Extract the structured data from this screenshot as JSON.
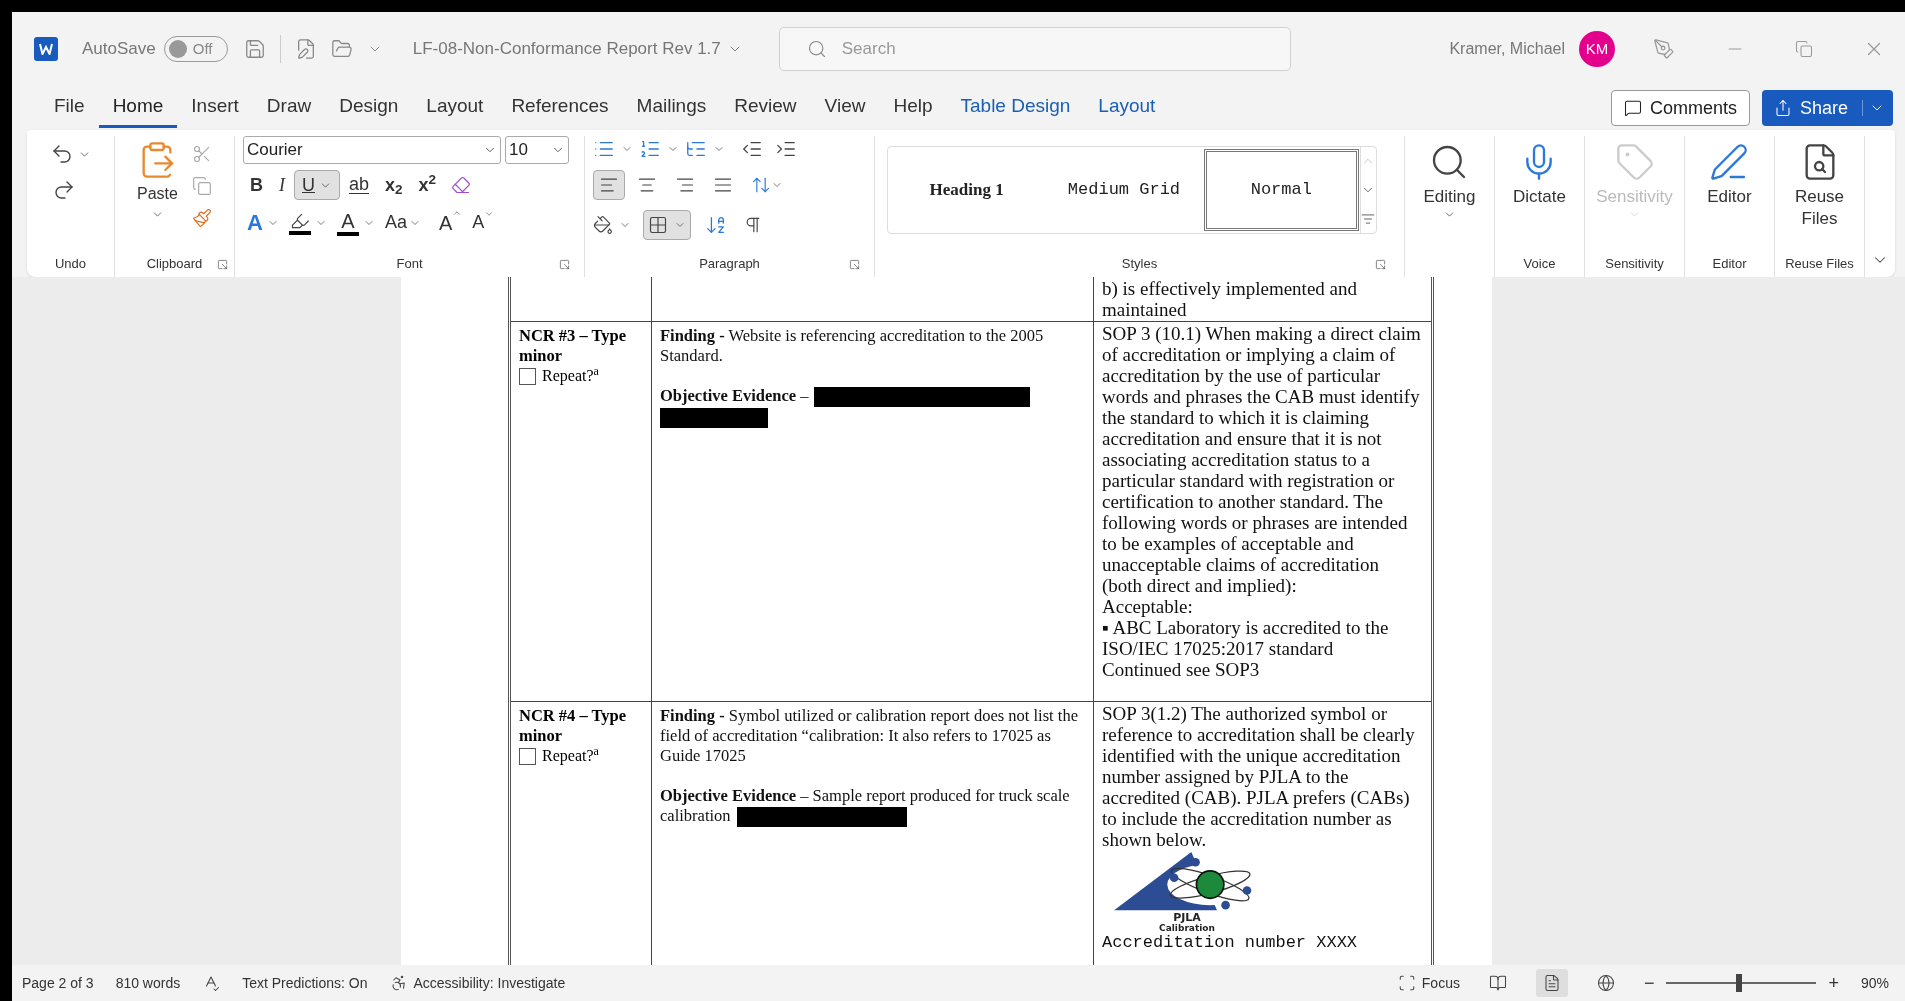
{
  "title_bar": {
    "autosave": {
      "label": "AutoSave",
      "state": "Off",
      "on": false
    },
    "document_title": "LF-08-Non-Conformance Report Rev 1.7",
    "search": {
      "placeholder": "Search"
    },
    "user_name": "Kramer, Michael",
    "user_initials": "KM"
  },
  "menu_tabs": [
    {
      "label": "File",
      "selected": false,
      "kind": "normal"
    },
    {
      "label": "Home",
      "selected": true,
      "kind": "normal"
    },
    {
      "label": "Insert",
      "selected": false,
      "kind": "normal"
    },
    {
      "label": "Draw",
      "selected": false,
      "kind": "normal"
    },
    {
      "label": "Design",
      "selected": false,
      "kind": "normal"
    },
    {
      "label": "Layout",
      "selected": false,
      "kind": "normal"
    },
    {
      "label": "References",
      "selected": false,
      "kind": "normal"
    },
    {
      "label": "Mailings",
      "selected": false,
      "kind": "normal"
    },
    {
      "label": "Review",
      "selected": false,
      "kind": "normal"
    },
    {
      "label": "View",
      "selected": false,
      "kind": "normal"
    },
    {
      "label": "Help",
      "selected": false,
      "kind": "normal"
    },
    {
      "label": "Table Design",
      "selected": false,
      "kind": "contextual"
    },
    {
      "label": "Layout",
      "selected": false,
      "kind": "contextual"
    }
  ],
  "comments_button": "Comments",
  "share_button": "Share",
  "ribbon": {
    "undo": {
      "label": "Undo"
    },
    "clipboard": {
      "label": "Clipboard",
      "paste": "Paste"
    },
    "font": {
      "label": "Font",
      "family": "Courier",
      "size": "10",
      "format_buttons": [
        {
          "kind": "bold",
          "label": "B",
          "selected": false
        },
        {
          "kind": "italic",
          "label": "I",
          "selected": false
        },
        {
          "kind": "underline",
          "label": "U",
          "selected": true
        },
        {
          "kind": "strikethrough",
          "label": "ab",
          "selected": false
        },
        {
          "kind": "subscript",
          "label": "x$_{2}$",
          "selected": false
        },
        {
          "kind": "superscript",
          "label": "x$^{2}$",
          "selected": false
        }
      ],
      "text_effects": "A",
      "font_color": "A",
      "change_case": "Aa",
      "grow": "A",
      "shrink": "A"
    },
    "paragraph": {
      "label": "Paragraph",
      "alignments": [
        {
          "kind": "left",
          "selected": true
        },
        {
          "kind": "center",
          "selected": false
        },
        {
          "kind": "right",
          "selected": false
        },
        {
          "kind": "justify",
          "selected": false
        }
      ],
      "borders_selected": true
    },
    "styles": {
      "label": "Styles",
      "items": [
        {
          "label": "Heading 1",
          "kind": "heading",
          "selected": false
        },
        {
          "label": "Medium Grid",
          "kind": "mono",
          "selected": false
        },
        {
          "label": "Normal",
          "kind": "mono",
          "selected": true
        }
      ]
    },
    "tools": [
      {
        "label": "Editing",
        "kind": "editing",
        "dropdown": true,
        "disabled": false
      },
      {
        "label": "Dictate",
        "kind": "dictate",
        "group": "Voice",
        "dropdown": false,
        "disabled": false
      },
      {
        "label": "Sensitivity",
        "kind": "sensitivity",
        "group": "Sensitivity",
        "dropdown": true,
        "disabled": true
      },
      {
        "label": "Editor",
        "kind": "editor",
        "group": "Editor",
        "dropdown": false,
        "disabled": false
      },
      {
        "label": "Reuse Files",
        "kind": "reuse",
        "group": "Reuse Files",
        "dropdown": false,
        "disabled": false
      }
    ]
  },
  "document": {
    "rows": [
      {
        "kind": "continued",
        "requirement": [
          "b) is effectively implemented and maintained"
        ]
      },
      {
        "kind": "ncr",
        "ncr": "NCR #3 – Type minor",
        "repeat": "Repeat?$^{a}$",
        "repeat_checked": false,
        "finding": "**Finding -**  Website is referencing accreditation to the 2005 Standard.",
        "evidence": "**Objective Evidence** –",
        "redactions": [
          {
            "kind": "wide"
          },
          {
            "kind": "short"
          }
        ],
        "requirement": [
          "SOP 3 (10.1) When making a direct claim of accreditation or implying a claim of accreditation by the use of particular words and phrases the CAB must identify the standard to which it is claiming accreditation and ensure that it is not associating accreditation status to a particular standard with registration or certification to another standard. The following words or phrases are intended to be examples of acceptable and unacceptable claims of accreditation (both direct and implied):",
          "Acceptable:",
          "▪ ABC Laboratory is accredited to the ISO/IEC 17025:2017 standard",
          "Continued see SOP3"
        ]
      },
      {
        "kind": "ncr",
        "ncr": "NCR #4 – Type minor",
        "repeat": "Repeat?$^{a}$",
        "repeat_checked": false,
        "finding": "**Finding -**  Symbol utilized or calibration report does not list the field of accreditation “calibration:  It also refers to 17025 as Guide 17025",
        "evidence": "**Objective Evidence** – Sample report produced for truck scale calibration",
        "redactions": [
          {
            "kind": "medium"
          }
        ],
        "requirement": [
          "SOP 3(1.2) The authorized symbol or reference to accreditation shall be clearly identified with the unique accreditation number assigned by PJLA to the accredited (CAB). PJLA prefers (CABs) to include the accreditation number as shown below."
        ],
        "logo": {
          "name": "PJLA",
          "caption": "Calibration"
        },
        "accreditation_number": "Accreditation number XXXX"
      }
    ]
  },
  "status_bar": {
    "page": "Page 2 of 3",
    "words": "810 words",
    "predictions": "Text Predictions: On",
    "accessibility": "Accessibility: Investigate",
    "focus": "Focus",
    "views": [
      {
        "kind": "read",
        "selected": false
      },
      {
        "kind": "print",
        "selected": true
      },
      {
        "kind": "web",
        "selected": false
      }
    ],
    "zoom_out": "−",
    "zoom_in": "+",
    "zoom": {
      "level": 0.48,
      "reading": "90%"
    }
  }
}
